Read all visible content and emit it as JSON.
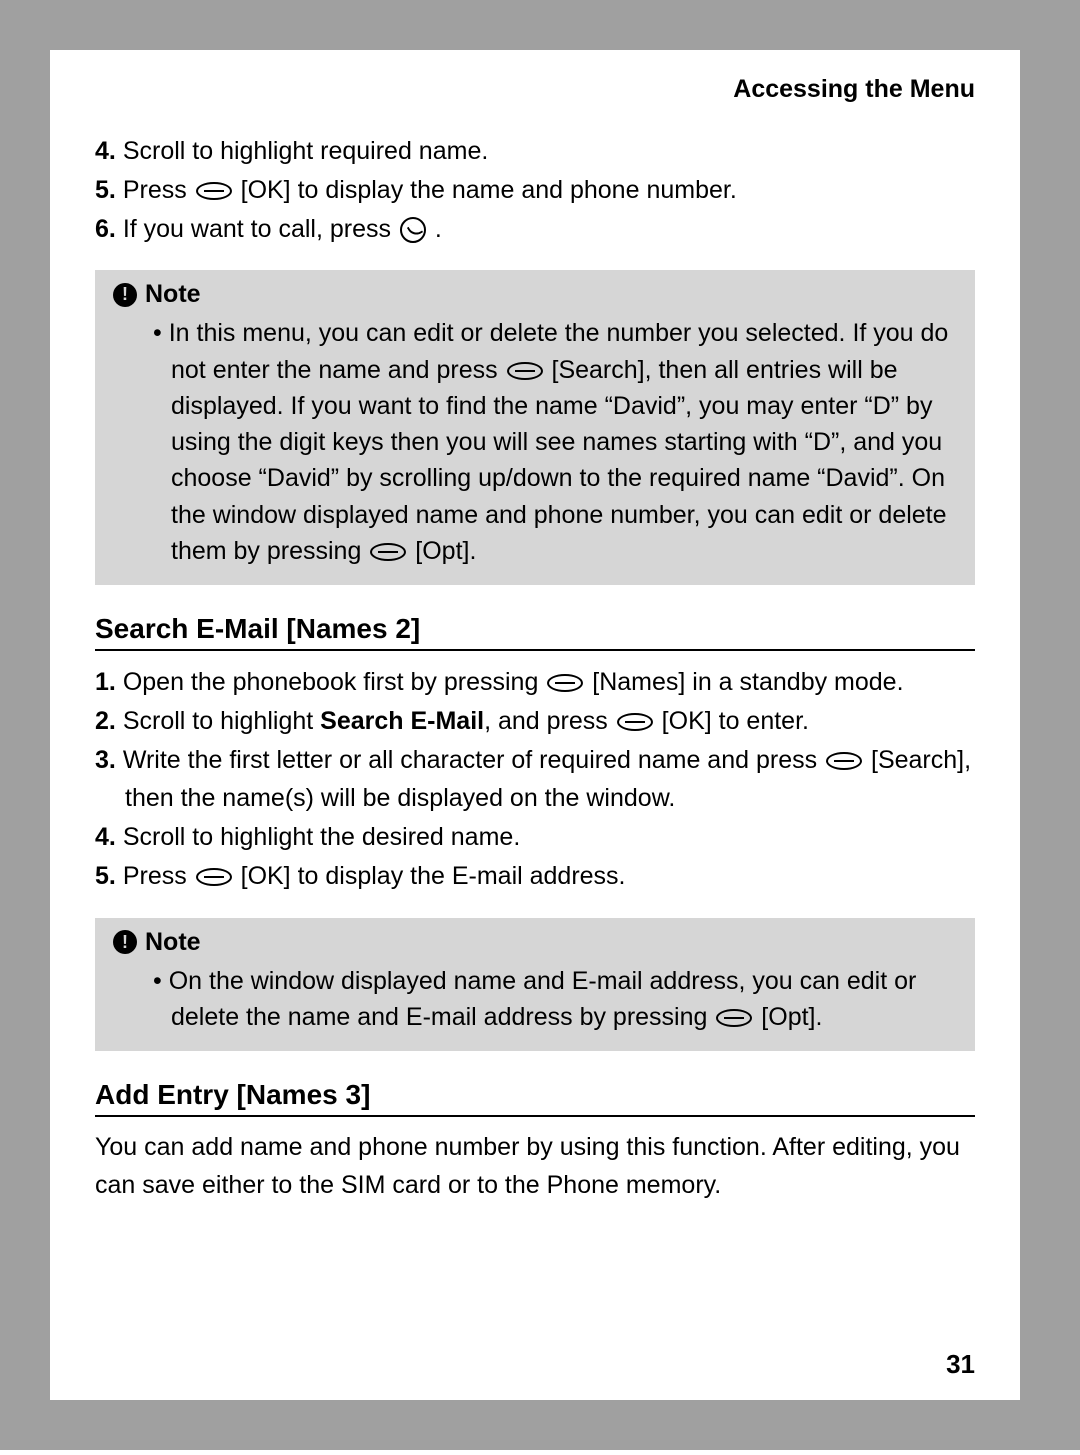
{
  "header": {
    "title": "Accessing the Menu"
  },
  "topSteps": {
    "s4": {
      "num": "4.",
      "text": "Scroll to highlight required name."
    },
    "s5": {
      "num": "5.",
      "pre": "Press ",
      "post": " [OK] to display the name and phone number."
    },
    "s6": {
      "num": "6.",
      "pre": "If you want to call, press ",
      "post": " ."
    }
  },
  "note1": {
    "label": "Note",
    "bullet_pre": "• In this menu, you can edit or delete the number you selected. If you do not enter the name and press ",
    "bullet_mid": " [Search], then all entries will be displayed. If you want to find the name “David”, you may enter “D” by using the digit keys then you will see names starting with “D”, and you choose “David” by scrolling up/down to the required name “David”. On the window displayed name and phone number, you can edit or delete them by pressing ",
    "bullet_post": " [Opt]."
  },
  "section2": {
    "heading": "Search E-Mail [Names 2]",
    "s1": {
      "num": "1.",
      "pre": "Open the phonebook first by pressing ",
      "post": " [Names] in a standby mode."
    },
    "s2": {
      "num": "2.",
      "pre": "Scroll to highlight ",
      "bold": "Search E-Mail",
      "mid": ", and press ",
      "post": " [OK] to enter."
    },
    "s3": {
      "num": "3.",
      "pre": "Write the first letter or all character of required name and press ",
      "post": " [Search], then the name(s) will be displayed on the window."
    },
    "s4": {
      "num": "4.",
      "text": "Scroll to highlight the desired name."
    },
    "s5": {
      "num": "5.",
      "pre": "Press ",
      "post": " [OK] to display the E-mail address."
    }
  },
  "note2": {
    "label": "Note",
    "bullet_pre": "• On the window displayed name and E-mail address, you can edit or delete the name and E-mail address by pressing ",
    "bullet_post": " [Opt]."
  },
  "section3": {
    "heading": "Add Entry [Names 3]",
    "para": "You can add name and phone number by using this function. After editing, you can save either to the SIM card or to the Phone memory."
  },
  "pageNumber": "31"
}
